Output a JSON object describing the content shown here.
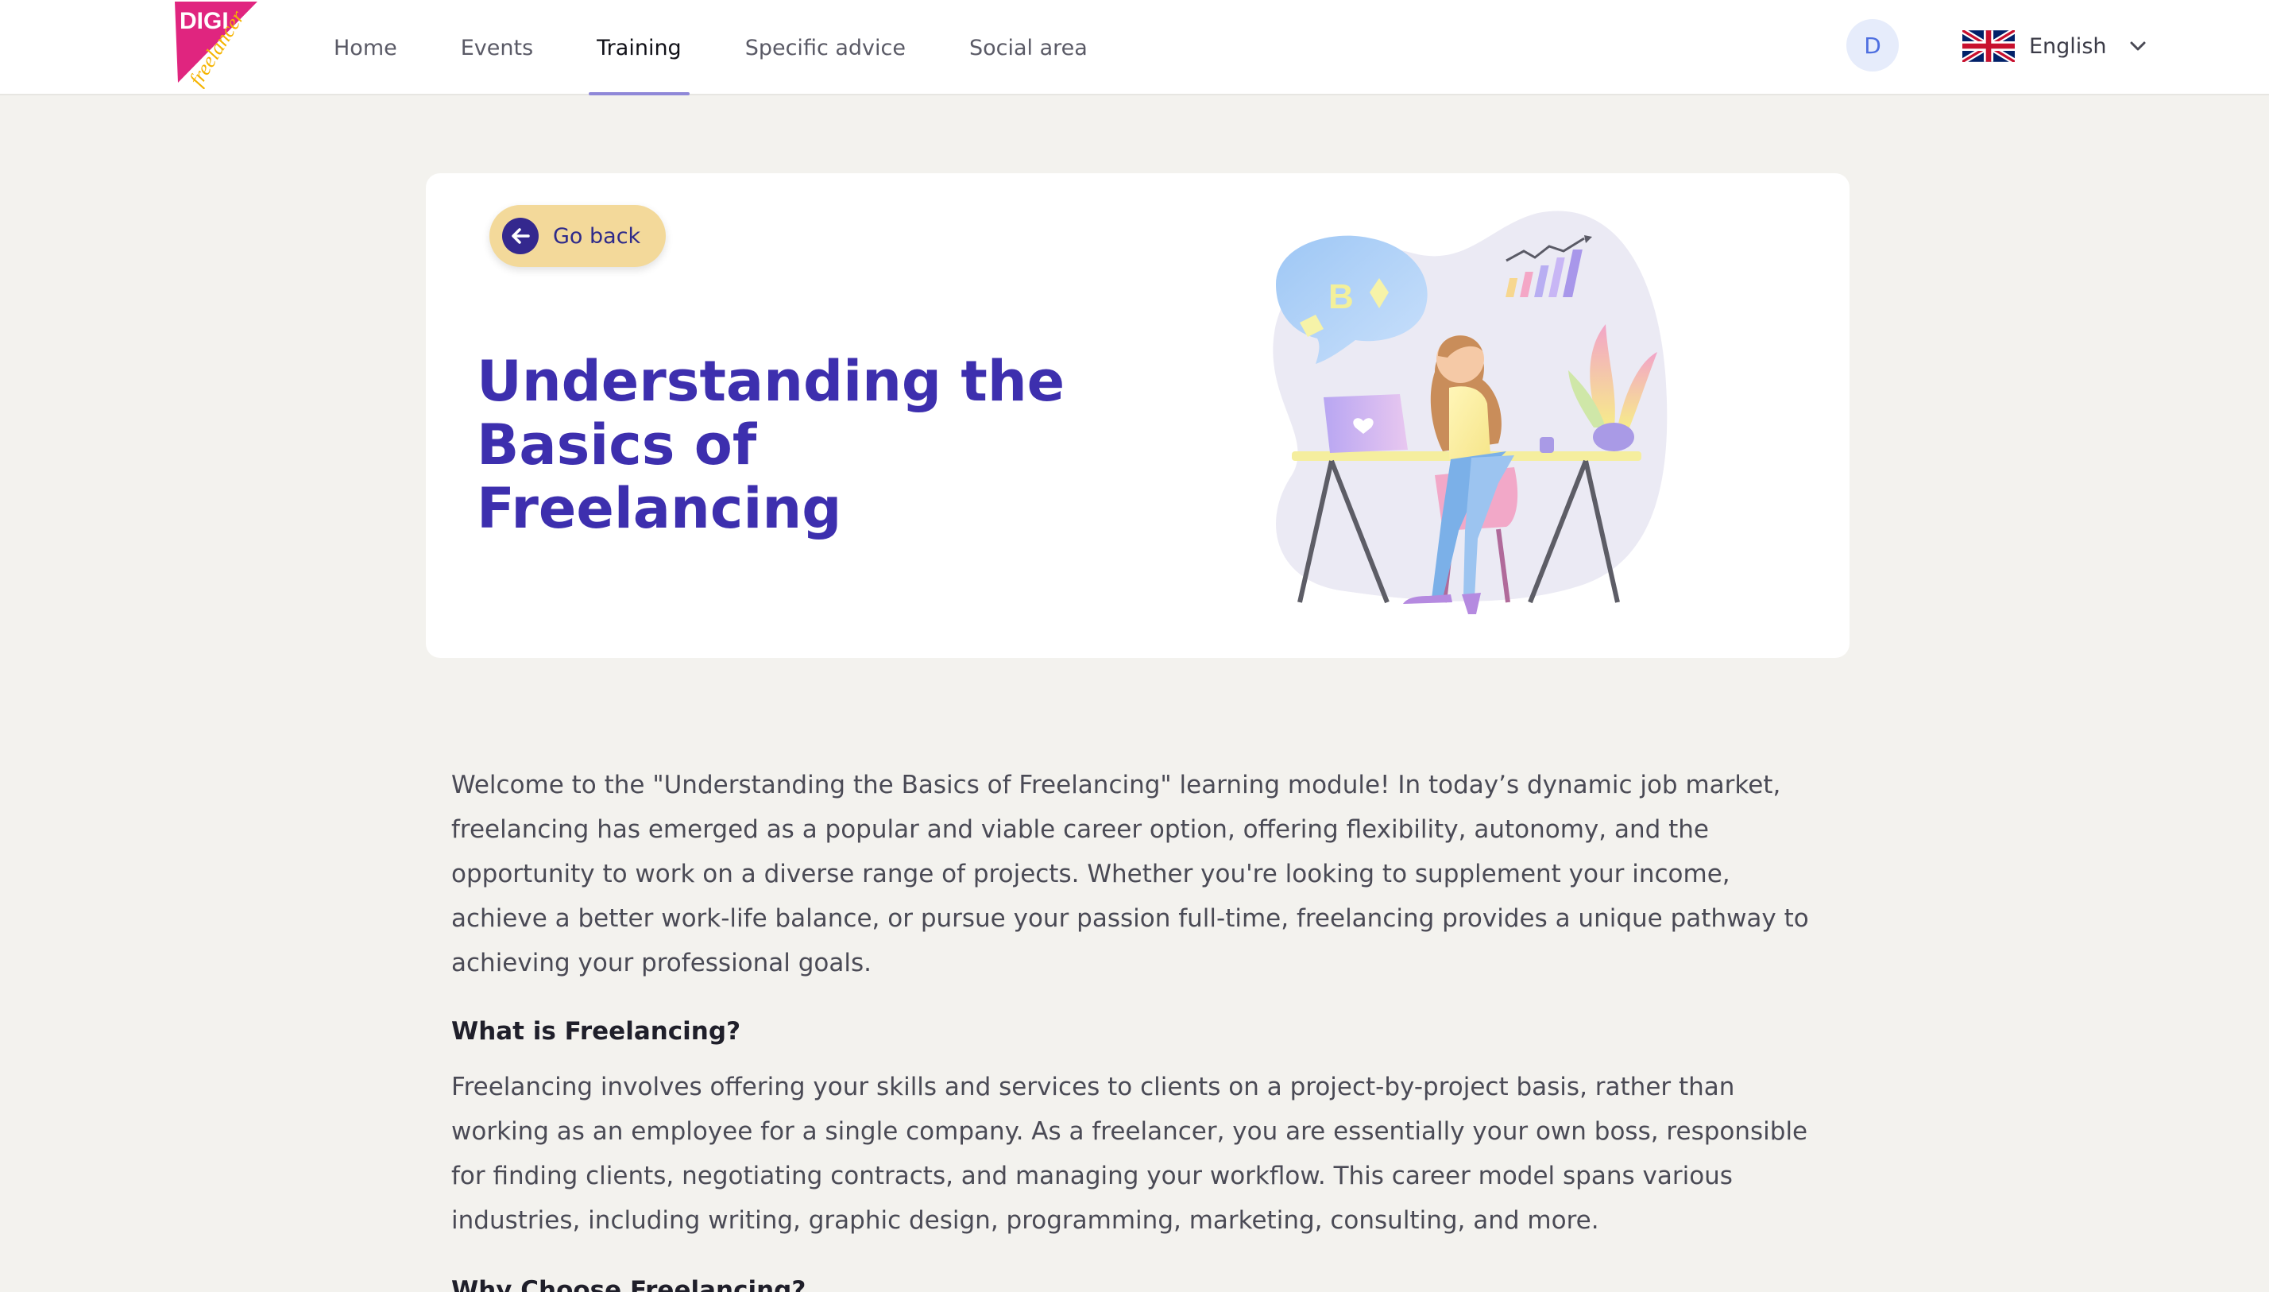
{
  "brand": {
    "logo_top": "DIGI",
    "logo_bottom": "freelancer"
  },
  "nav": {
    "items": [
      {
        "label": "Home",
        "active": false
      },
      {
        "label": "Events",
        "active": false
      },
      {
        "label": "Training",
        "active": true
      },
      {
        "label": "Specific advice",
        "active": false
      },
      {
        "label": "Social area",
        "active": false
      }
    ]
  },
  "user": {
    "initial": "D"
  },
  "language": {
    "selected": "English",
    "flag_icon": "uk-flag-icon"
  },
  "hero": {
    "back_label": "Go back",
    "title_line1": "Understanding the",
    "title_line2": "Basics of Freelancing"
  },
  "article": {
    "intro": "Welcome to the \"Understanding the Basics of Freelancing\" learning module! In today’s dynamic job market, freelancing has emerged as a popular and viable career option, offering flexibility, autonomy, and the opportunity to work on a diverse range of projects. Whether you're looking to supplement your income, achieve a better work-life balance, or pursue your passion full-time, freelancing provides a unique pathway to achieving your professional goals.",
    "section1_heading": "What is Freelancing?",
    "section1_body": "Freelancing involves offering your skills and services to clients on a project-by-project basis, rather than working as an employee for a single company. As a freelancer, you are essentially your own boss, responsible for finding clients, negotiating contracts, and managing your workflow. This career model spans various industries, including writing, graphic design, programming, marketing, consulting, and more.",
    "section2_heading": "Why Choose Freelancing?"
  },
  "colors": {
    "accent": "#3d2fae",
    "button_bg": "#f3d99a",
    "page_bg": "#f3f2ee",
    "nav_underline": "#8f88d8",
    "logo_pink": "#e0257f",
    "logo_yellow": "#f5b400"
  }
}
